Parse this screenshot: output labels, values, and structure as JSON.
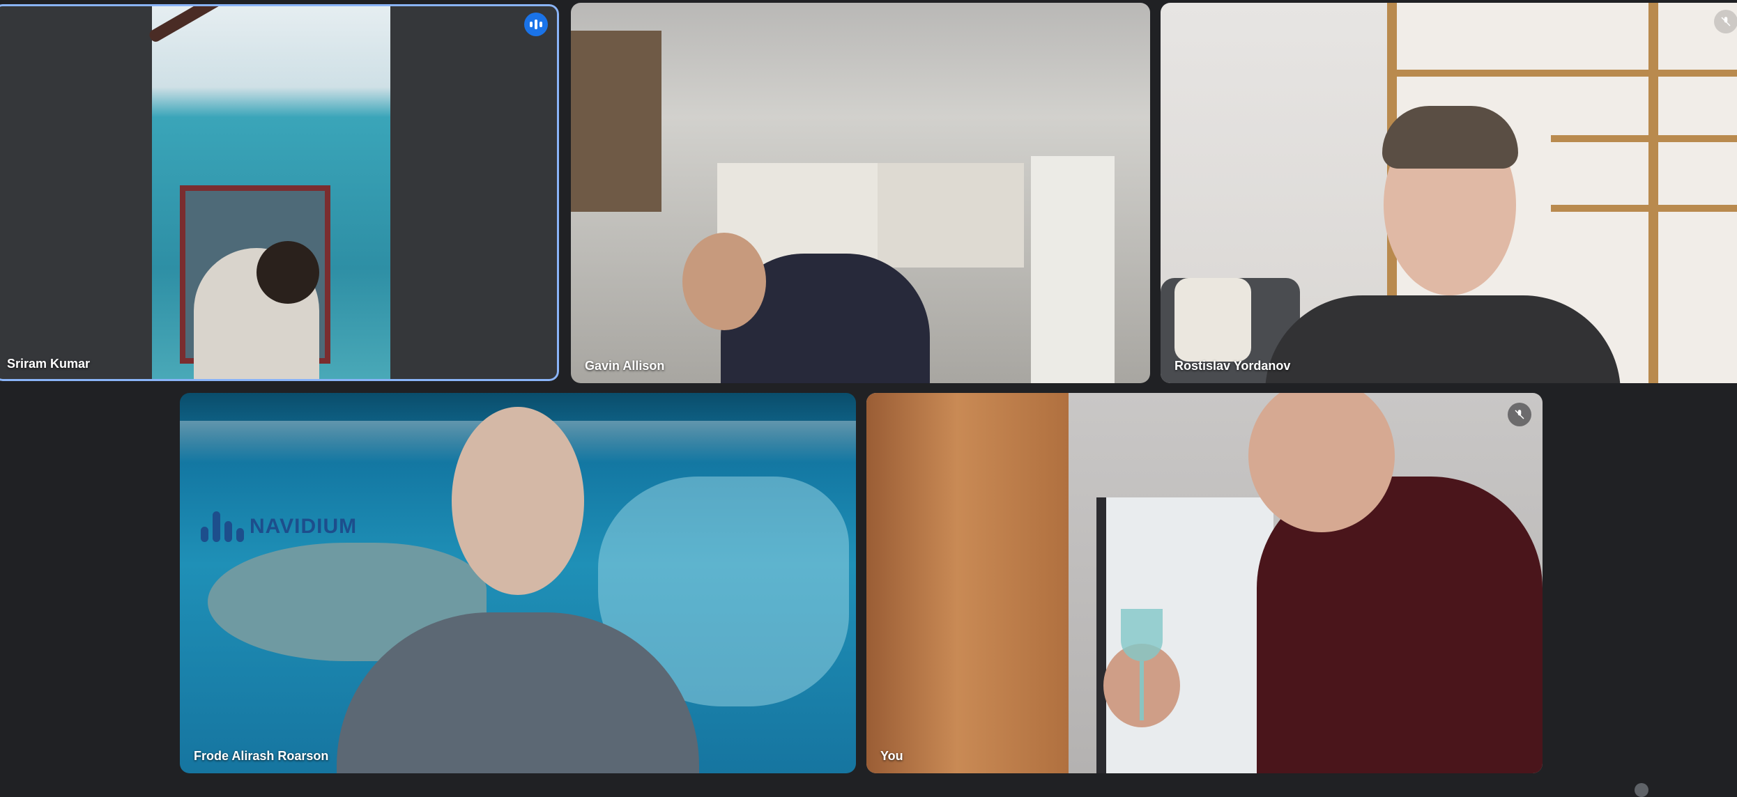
{
  "participants": [
    {
      "name": "Sriram Kumar",
      "speaking": true
    },
    {
      "name": "Gavin Allison",
      "speaking": false
    },
    {
      "name": "Rostislav Yordanov",
      "speaking": false,
      "muted": true
    },
    {
      "name": "Frode Alirash Roarson",
      "speaking": false
    },
    {
      "name": "You",
      "speaking": false,
      "muted": true
    }
  ],
  "background_logo": "NAVIDIUM",
  "colors": {
    "background": "#202124",
    "active_speaker_border": "#8ab4f8",
    "speaking_badge": "#1a73e8"
  }
}
